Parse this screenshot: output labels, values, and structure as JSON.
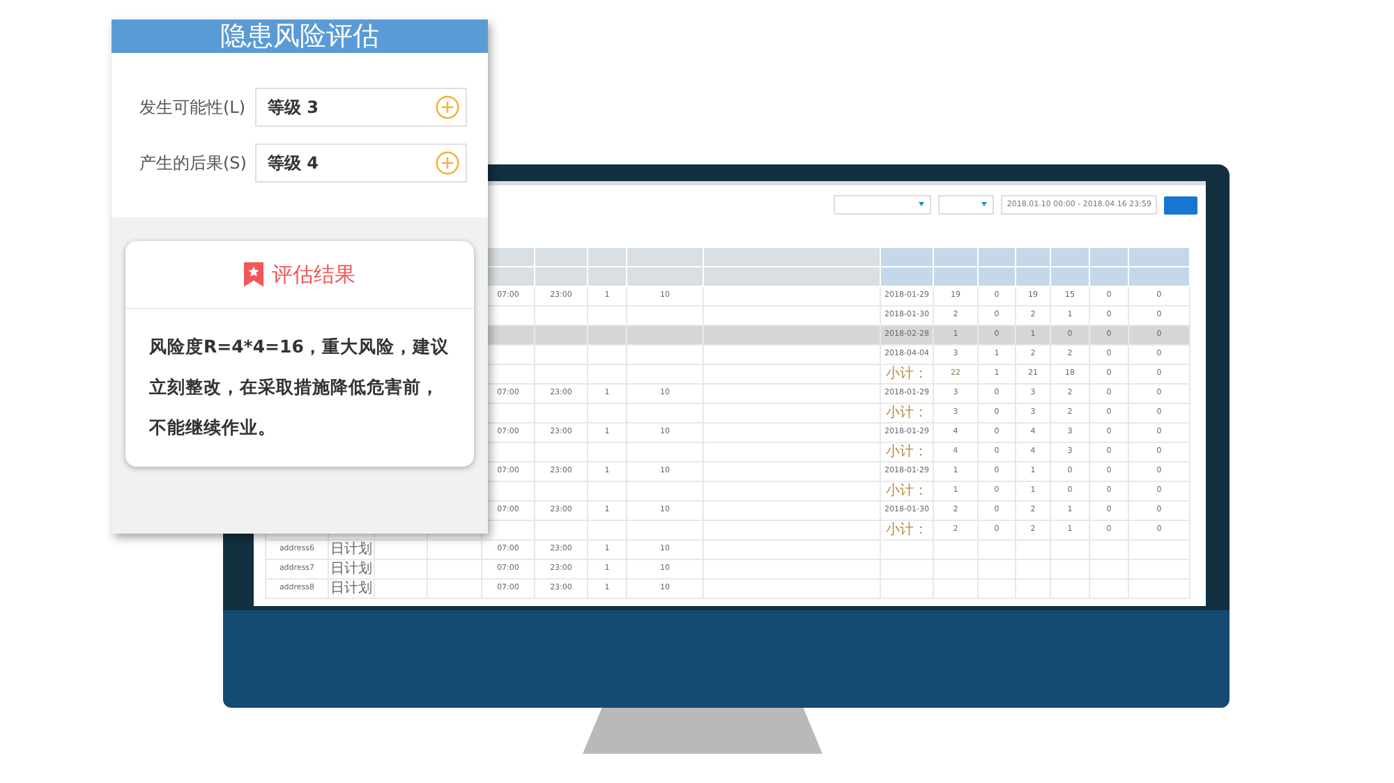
{
  "monitor": {
    "toolbar": {
      "date_range": "2018.01.10 00:00 - 2018.04.16 23:59"
    },
    "table": {
      "rows": [
        {
          "kind": "detail",
          "highlighted": false,
          "start": "07:00",
          "end": "23:00",
          "count": "1",
          "allow": "10",
          "date": "2018-01-29",
          "values": [
            "19",
            "0",
            "19",
            "15",
            "0",
            "0"
          ]
        },
        {
          "kind": "detail",
          "highlighted": false,
          "date": "2018-01-30",
          "values": [
            "2",
            "0",
            "2",
            "1",
            "0",
            "0"
          ]
        },
        {
          "kind": "detail",
          "highlighted": true,
          "date": "2018-02-28",
          "values": [
            "1",
            "0",
            "1",
            "0",
            "0",
            "0"
          ]
        },
        {
          "kind": "detail",
          "highlighted": false,
          "date": "2018-04-04",
          "values": [
            "3",
            "1",
            "2",
            "2",
            "0",
            "0"
          ]
        },
        {
          "kind": "subtotal",
          "highlighted": false,
          "date": "小计：",
          "values": [
            "22",
            "1",
            "21",
            "18",
            "0",
            "0"
          ]
        },
        {
          "kind": "detail",
          "highlighted": false,
          "start": "07:00",
          "end": "23:00",
          "count": "1",
          "allow": "10",
          "date": "2018-01-29",
          "values": [
            "3",
            "0",
            "3",
            "2",
            "0",
            "0"
          ]
        },
        {
          "kind": "subtotal",
          "highlighted": false,
          "date": "小计：",
          "values": [
            "3",
            "0",
            "3",
            "2",
            "0",
            "0"
          ]
        },
        {
          "kind": "detail",
          "highlighted": false,
          "start": "07:00",
          "end": "23:00",
          "count": "1",
          "allow": "10",
          "date": "2018-01-29",
          "values": [
            "4",
            "0",
            "4",
            "3",
            "0",
            "0"
          ]
        },
        {
          "kind": "subtotal",
          "highlighted": false,
          "date": "小计：",
          "values": [
            "4",
            "0",
            "4",
            "3",
            "0",
            "0"
          ]
        },
        {
          "kind": "detail",
          "highlighted": false,
          "start": "07:00",
          "end": "23:00",
          "count": "1",
          "allow": "10",
          "date": "2018-01-29",
          "values": [
            "1",
            "0",
            "1",
            "0",
            "0",
            "0"
          ]
        },
        {
          "kind": "subtotal",
          "highlighted": false,
          "date": "小计：",
          "values": [
            "1",
            "0",
            "1",
            "0",
            "0",
            "0"
          ]
        },
        {
          "kind": "detail",
          "highlighted": false,
          "start": "07:00",
          "end": "23:00",
          "count": "1",
          "allow": "10",
          "date": "2018-01-30",
          "values": [
            "2",
            "0",
            "2",
            "1",
            "0",
            "0"
          ]
        },
        {
          "kind": "subtotal",
          "highlighted": false,
          "date": "小计：",
          "values": [
            "2",
            "0",
            "2",
            "1",
            "0",
            "0"
          ]
        },
        {
          "kind": "detail",
          "highlighted": false,
          "address": "address6",
          "plan": "日计划",
          "start": "07:00",
          "end": "23:00",
          "count": "1",
          "allow": "10"
        },
        {
          "kind": "detail",
          "highlighted": false,
          "address": "address7",
          "plan": "日计划",
          "start": "07:00",
          "end": "23:00",
          "count": "1",
          "allow": "10"
        },
        {
          "kind": "detail",
          "highlighted": false,
          "address": "address8",
          "plan": "日计划",
          "start": "07:00",
          "end": "23:00",
          "count": "1",
          "allow": "10"
        }
      ]
    }
  },
  "panel": {
    "title": "隐患风险评估",
    "fields": [
      {
        "label": "发生可能性(L)",
        "value": "等级 3"
      },
      {
        "label": "产生的后果(S)",
        "value": "等级 4"
      }
    ],
    "result": {
      "heading": "评估结果",
      "text": "风险度R=4*4=16，重大风险，建议立刻整改，在采取措施降低危害前，不能继续作业。"
    }
  }
}
